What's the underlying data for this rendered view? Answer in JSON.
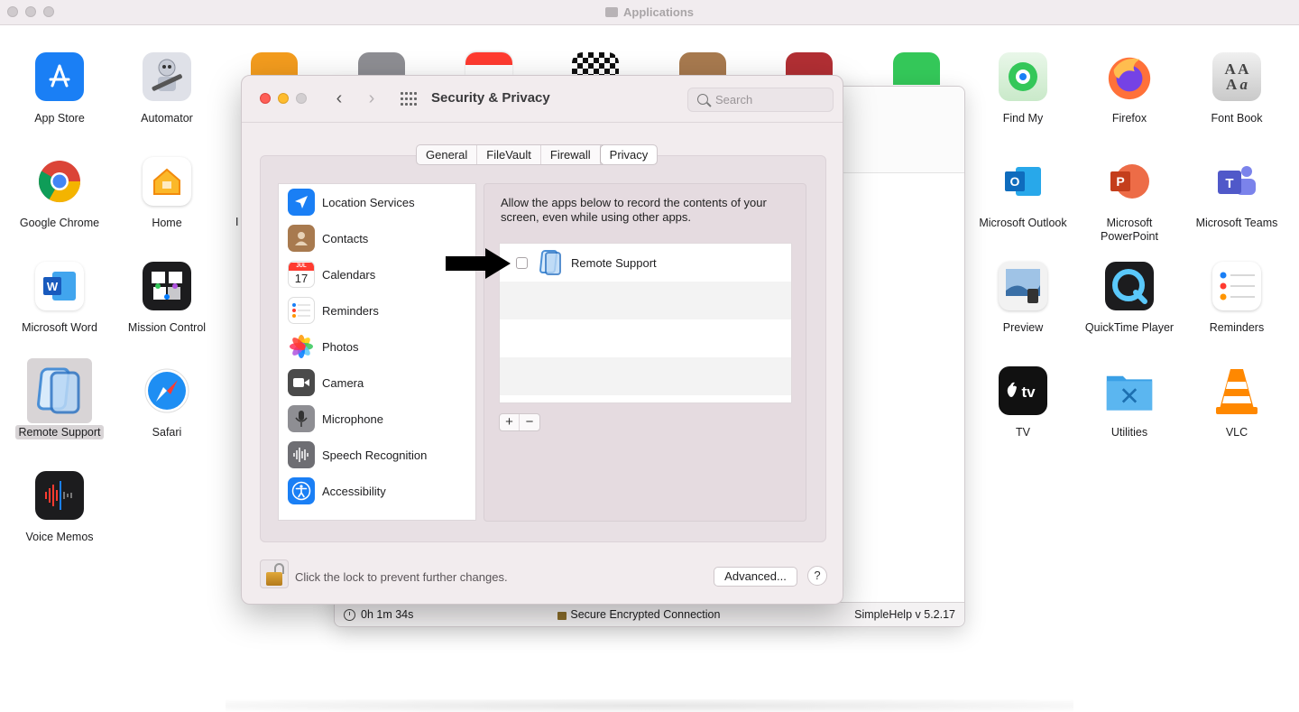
{
  "finder": {
    "title": "Applications",
    "apps_left": [
      {
        "name": "App Store",
        "color": "#1a7ff5"
      },
      {
        "name": "Automator",
        "color": "#c9ccd6"
      },
      {
        "name": "Google Chrome",
        "color": "#ffffff"
      },
      {
        "name": "Home",
        "color": "#ffffff"
      },
      {
        "name": "Microsoft Word",
        "color": "#ffffff"
      },
      {
        "name": "Mission Control",
        "color": "#222222"
      },
      {
        "name": "Remote Support",
        "color": "#d9ebfb"
      },
      {
        "name": "Safari",
        "color": "#ffffff"
      },
      {
        "name": "Voice Memos",
        "color": "#222222"
      }
    ],
    "apps_right": [
      {
        "name": "Find My",
        "color": "#e8f4e8"
      },
      {
        "name": "Firefox",
        "color": "#ff7139"
      },
      {
        "name": "Font Book",
        "color": "#e4e4e4"
      },
      {
        "name": "Microsoft Outlook",
        "color": "#0f6cbd"
      },
      {
        "name": "Microsoft PowerPoint",
        "color": "#c43e1c"
      },
      {
        "name": "Microsoft Teams",
        "color": "#5059c9"
      },
      {
        "name": "Preview",
        "color": "#dfe9f3"
      },
      {
        "name": "QuickTime Player",
        "color": "#1c1c1e"
      },
      {
        "name": "Reminders",
        "color": "#ffffff"
      },
      {
        "name": "TV",
        "color": "#111111"
      },
      {
        "name": "Utilities",
        "color": "#3aa0e6"
      },
      {
        "name": "VLC",
        "color": "#ff8800"
      }
    ],
    "partial_label": "I"
  },
  "simplehelp": {
    "timer": "0h 1m 34s",
    "connection": "Secure Encrypted Connection",
    "version": "SimpleHelp v 5.2.17"
  },
  "prefs": {
    "title": "Security & Privacy",
    "search_placeholder": "Search",
    "tabs": [
      "General",
      "FileVault",
      "Firewall",
      "Privacy"
    ],
    "active_tab": "Privacy",
    "sidebar": [
      {
        "label": "Location Services",
        "icon": "location-icon",
        "color": "#1a7ff5"
      },
      {
        "label": "Contacts",
        "icon": "contacts-icon",
        "color": "#a87a4f"
      },
      {
        "label": "Calendars",
        "icon": "calendar-icon",
        "color": "#ffffff"
      },
      {
        "label": "Reminders",
        "icon": "reminders-icon",
        "color": "#ffffff"
      },
      {
        "label": "Photos",
        "icon": "photos-icon",
        "color": "#ffffff"
      },
      {
        "label": "Camera",
        "icon": "camera-icon",
        "color": "#4a4a4a"
      },
      {
        "label": "Microphone",
        "icon": "microphone-icon",
        "color": "#8e8e93"
      },
      {
        "label": "Speech Recognition",
        "icon": "speech-icon",
        "color": "#6e6e73"
      },
      {
        "label": "Accessibility",
        "icon": "accessibility-icon",
        "color": "#1a7ff5"
      }
    ],
    "calendar_month": "JUL",
    "calendar_day": "17",
    "description": "Allow the apps below to record the contents of your screen, even while using other apps.",
    "app_rows": [
      {
        "label": "Remote Support",
        "checked": false
      }
    ],
    "plus": "+",
    "minus": "−",
    "lock_text": "Click the lock to prevent further changes.",
    "advanced_label": "Advanced...",
    "help_label": "?"
  }
}
